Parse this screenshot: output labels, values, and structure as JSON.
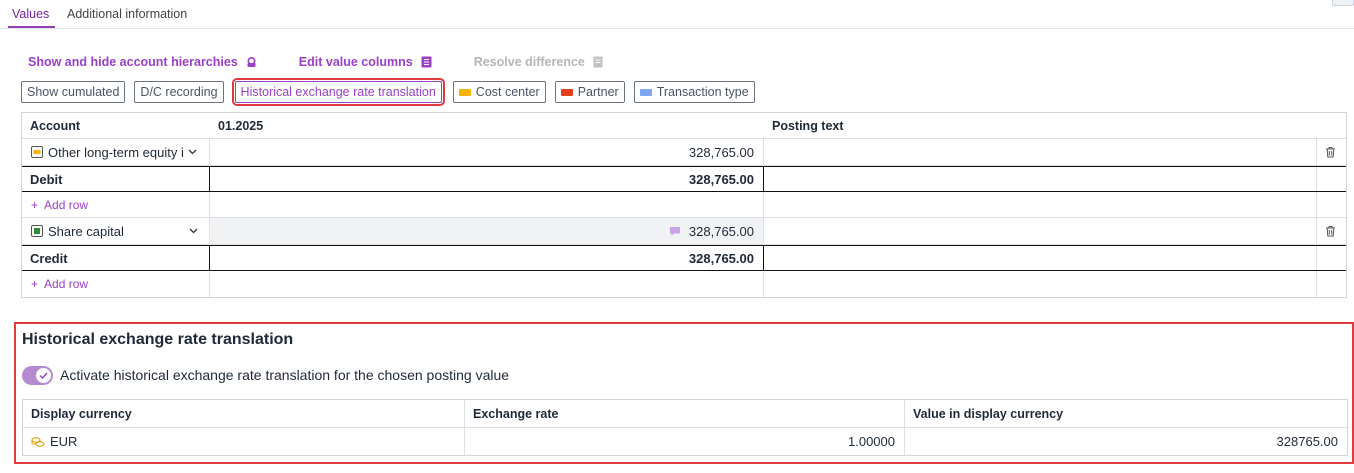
{
  "tabs": [
    {
      "label": "Values",
      "active": true
    },
    {
      "label": "Additional information",
      "active": false
    }
  ],
  "toolbar": {
    "show_hide_label": "Show and hide account hierarchies",
    "edit_columns_label": "Edit value columns",
    "resolve_label": "Resolve difference"
  },
  "chips": {
    "show_cumulated": "Show cumulated",
    "dc_recording": "D/C recording",
    "historical": "Historical exchange rate translation",
    "cost_center": "Cost center",
    "partner": "Partner",
    "transaction_type": "Transaction type"
  },
  "chip_colors": {
    "cost_center": "#f5b400",
    "partner": "#e0401e",
    "transaction_type": "#7ea6f2"
  },
  "grid": {
    "headers": {
      "account": "Account",
      "period": "01.2025",
      "posting_text": "Posting text"
    },
    "debit_row": {
      "account": "Other long-term equity i",
      "value": "328,765.00",
      "icon": "account-icon"
    },
    "debit_sum": {
      "label": "Debit",
      "value": "328,765.00"
    },
    "add_row_label": "Add row",
    "credit_row": {
      "account": "Share capital",
      "value": "328,765.00",
      "icon": "account-icon"
    },
    "credit_sum": {
      "label": "Credit",
      "value": "328,765.00"
    }
  },
  "historical_panel": {
    "title": "Historical exchange rate translation",
    "toggle_label": "Activate historical exchange rate translation for the chosen posting value",
    "toggle_on": true,
    "headers": {
      "currency": "Display currency",
      "rate": "Exchange rate",
      "value": "Value in display currency"
    },
    "row": {
      "currency": "EUR",
      "rate": "1.00000",
      "value": "328765.00"
    }
  },
  "colors": {
    "accent": "#9b3fc6",
    "highlight": "#e03b3b"
  }
}
